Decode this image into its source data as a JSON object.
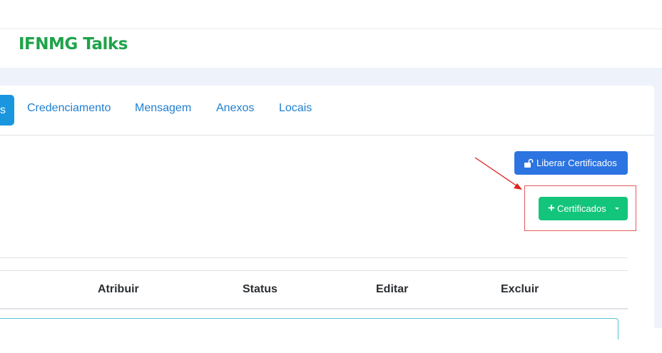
{
  "header": {
    "brand": "IFNMG Talks"
  },
  "tabs": {
    "active_fragment": "s",
    "items": [
      "Credenciamento",
      "Mensagem",
      "Anexos",
      "Locais"
    ]
  },
  "actions": {
    "liberar_label": "Liberar Certificados",
    "certificados_label": "Certificados"
  },
  "table": {
    "columns": [
      "Atribuir",
      "Status",
      "Editar",
      "Excluir"
    ]
  },
  "colors": {
    "brand": "#1fa34a",
    "primary": "#2c74e1",
    "success": "#13c57b",
    "tab_active": "#1a96df",
    "annotation": "#e35a5a"
  },
  "icons": {
    "liberar": "unlock-icon",
    "certificados": "plus-icon",
    "dropdown": "caret-down-icon"
  }
}
